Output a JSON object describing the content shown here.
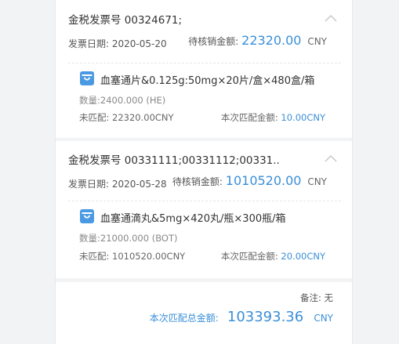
{
  "invoices": [
    {
      "title": "金税发票号 00324671;",
      "date_label": "发票日期:",
      "date": "2020-05-20",
      "pending_label": "待核销金额:",
      "pending_amount": "22320.00",
      "currency": "CNY",
      "item": {
        "icon": "shopping-bag-icon",
        "name": "血塞通片&0.125g:50mg×20片/盒×480盒/箱",
        "qty": "数量:2400.000 (HE)",
        "unmatched": "未匹配: 22320.00CNY",
        "this_match_label": "本次匹配金额:",
        "this_match_value": "10.00CNY"
      }
    },
    {
      "title": "金税发票号 00331111;00331112;00331...",
      "date_label": "发票日期:",
      "date": "2020-05-28",
      "pending_label": "待核销金额:",
      "pending_amount": "1010520.00",
      "currency": "CNY",
      "item": {
        "icon": "shopping-bag-icon",
        "name": "血塞通滴丸&5mg×420丸/瓶×300瓶/箱",
        "qty": "数量:21000.000 (BOT)",
        "unmatched": "未匹配: 1010520.00CNY",
        "this_match_label": "本次匹配金额:",
        "this_match_value": "20.00CNY"
      }
    }
  ],
  "footer": {
    "remark": "备注: 无",
    "total_label": "本次匹配总金额:",
    "total_amount": "103393.36",
    "currency": "CNY"
  },
  "colors": {
    "accent": "#3a8fd9",
    "background": "#f2f3f5"
  }
}
